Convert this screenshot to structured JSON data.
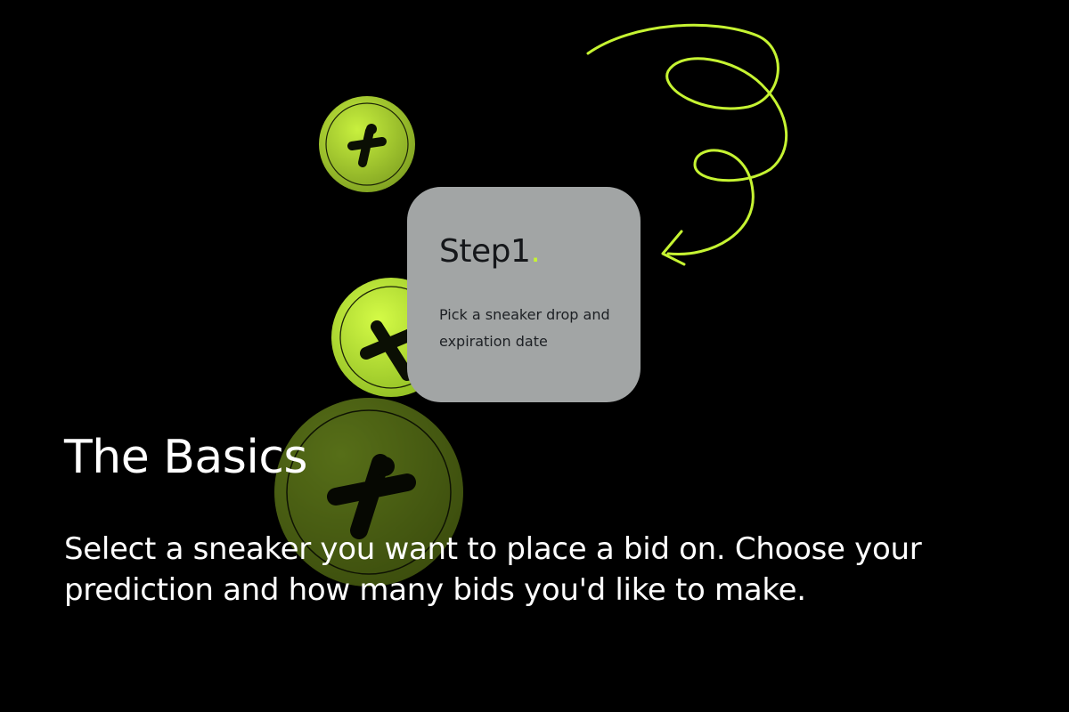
{
  "colors": {
    "background": "#000000",
    "accent": "#c6f432",
    "card": "#a2a5a5",
    "text": "#ffffff"
  },
  "step_card": {
    "title": "Step1",
    "dot": ".",
    "description": "Pick a sneaker drop and expiration date"
  },
  "heading": "The Basics",
  "body": "Select a sneaker you want to place a bid on. Choose your prediction and how many bids you'd like to make.",
  "icons": [
    "logo-coin-icon",
    "logo-coin-icon",
    "logo-coin-icon",
    "arrow-squiggle-icon"
  ]
}
